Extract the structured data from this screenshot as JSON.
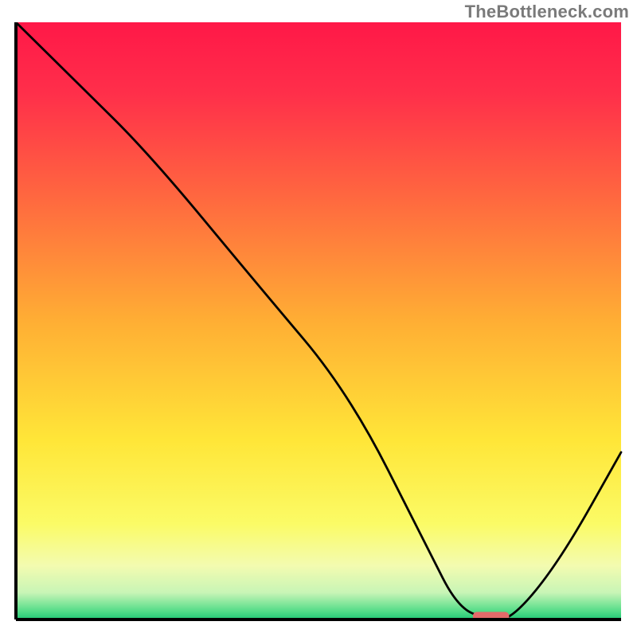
{
  "watermark": "TheBottleneck.com",
  "chart_data": {
    "type": "line",
    "title": "",
    "xlabel": "",
    "ylabel": "",
    "xlim": [
      0,
      100
    ],
    "ylim": [
      0,
      100
    ],
    "grid": false,
    "series": [
      {
        "name": "bottleneck-curve",
        "x": [
          0,
          10,
          22,
          40,
          55,
          68,
          73,
          78,
          82,
          90,
          100
        ],
        "y": [
          100,
          90,
          78,
          56,
          38,
          12,
          2,
          0,
          0,
          10,
          28
        ]
      }
    ],
    "optimal_marker": {
      "x_start": 75.5,
      "x_end": 81.5,
      "y": 0.6,
      "color": "#e46a6a"
    },
    "background": {
      "type": "vertical-gradient",
      "stops": [
        {
          "pos": 0.0,
          "color": "#ff1848"
        },
        {
          "pos": 0.12,
          "color": "#ff2f4a"
        },
        {
          "pos": 0.3,
          "color": "#ff6a3f"
        },
        {
          "pos": 0.5,
          "color": "#ffae34"
        },
        {
          "pos": 0.7,
          "color": "#ffe638"
        },
        {
          "pos": 0.84,
          "color": "#fbfb66"
        },
        {
          "pos": 0.91,
          "color": "#f3fbb0"
        },
        {
          "pos": 0.955,
          "color": "#c8f5b6"
        },
        {
          "pos": 0.985,
          "color": "#58dd8a"
        },
        {
          "pos": 1.0,
          "color": "#20c874"
        }
      ]
    },
    "axis_color": "#000000",
    "line_color": "#000000",
    "line_width": 2.8
  }
}
